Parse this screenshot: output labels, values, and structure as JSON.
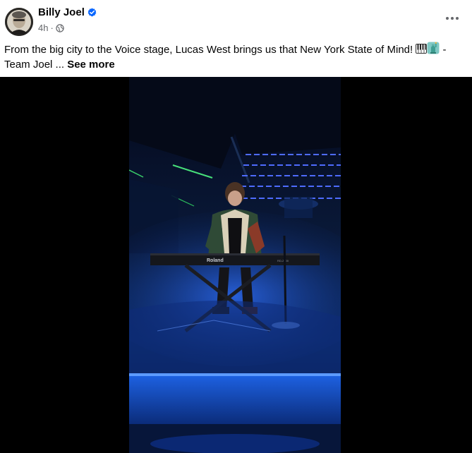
{
  "post": {
    "author": "Billy Joel",
    "verified": true,
    "time": "4h",
    "separator": "·",
    "privacy_icon": "globe-icon",
    "menu_icon": "more-options-icon",
    "caption_text": "From the big city to the Voice stage, Lucas West brings us that New York State of Mind! ",
    "caption_emojis": [
      "piano-keys-emoji",
      "statue-of-liberty-emoji"
    ],
    "caption_tail": " - Team Joel ... ",
    "see_more": "See more"
  },
  "video": {
    "keyboard_brand": "Roland",
    "keyboard_model": "RD-2000"
  },
  "colors": {
    "verified_blue": "#0866ff",
    "secondary_text": "#65676b",
    "video_bg": "#000000",
    "stage_blue": "#1a4fd6"
  }
}
